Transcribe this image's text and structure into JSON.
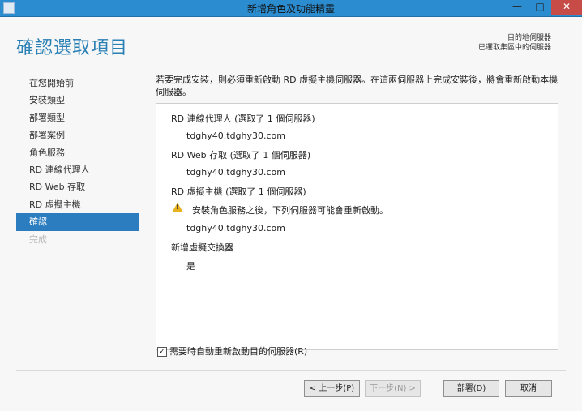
{
  "window": {
    "title": "新增角色及功能精靈",
    "controls": {
      "minimize": "—",
      "maximize": "□",
      "close": "✕"
    }
  },
  "header": {
    "page_title": "確認選取項目",
    "dest_label": "目的地伺服器",
    "dest_value": "已選取集區中的伺服器"
  },
  "sidebar": {
    "items": [
      {
        "label": "在您開始前"
      },
      {
        "label": "安裝類型"
      },
      {
        "label": "部署類型"
      },
      {
        "label": "部署案例"
      },
      {
        "label": "角色服務"
      },
      {
        "label": "RD 連線代理人"
      },
      {
        "label": "RD Web 存取"
      },
      {
        "label": "RD 虛擬主機"
      },
      {
        "label": "確認"
      },
      {
        "label": "完成"
      }
    ]
  },
  "main": {
    "intro": "若要完成安裝，則必須重新啟動 RD 虛擬主機伺服器。在這兩伺服器上完成安裝後，將會重新啟動本機伺服器。",
    "sections": {
      "broker_title": "RD 連線代理人 (選取了 1 個伺服器)",
      "broker_host": "tdghy40.tdghy30.com",
      "web_title": "RD Web 存取 (選取了 1 個伺服器)",
      "web_host": "tdghy40.tdghy30.com",
      "virt_title": "RD 虛擬主機 (選取了 1 個伺服器)",
      "virt_warning": "安裝角色服務之後，下列伺服器可能會重新啟動。",
      "virt_host": "tdghy40.tdghy30.com",
      "switch_title": "新增虛擬交換器",
      "switch_value": "是"
    },
    "restart_label": "需要時自動重新啟動目的伺服器(R)",
    "restart_checked": true
  },
  "footer": {
    "prev": "< 上一步(P)",
    "next": "下一步(N) >",
    "deploy": "部署(D)",
    "cancel": "取消"
  },
  "colors": {
    "accent": "#2c7dbf",
    "titlebar": "#2b8ccf",
    "close": "#c74b46",
    "warning": "#e8b21e"
  }
}
